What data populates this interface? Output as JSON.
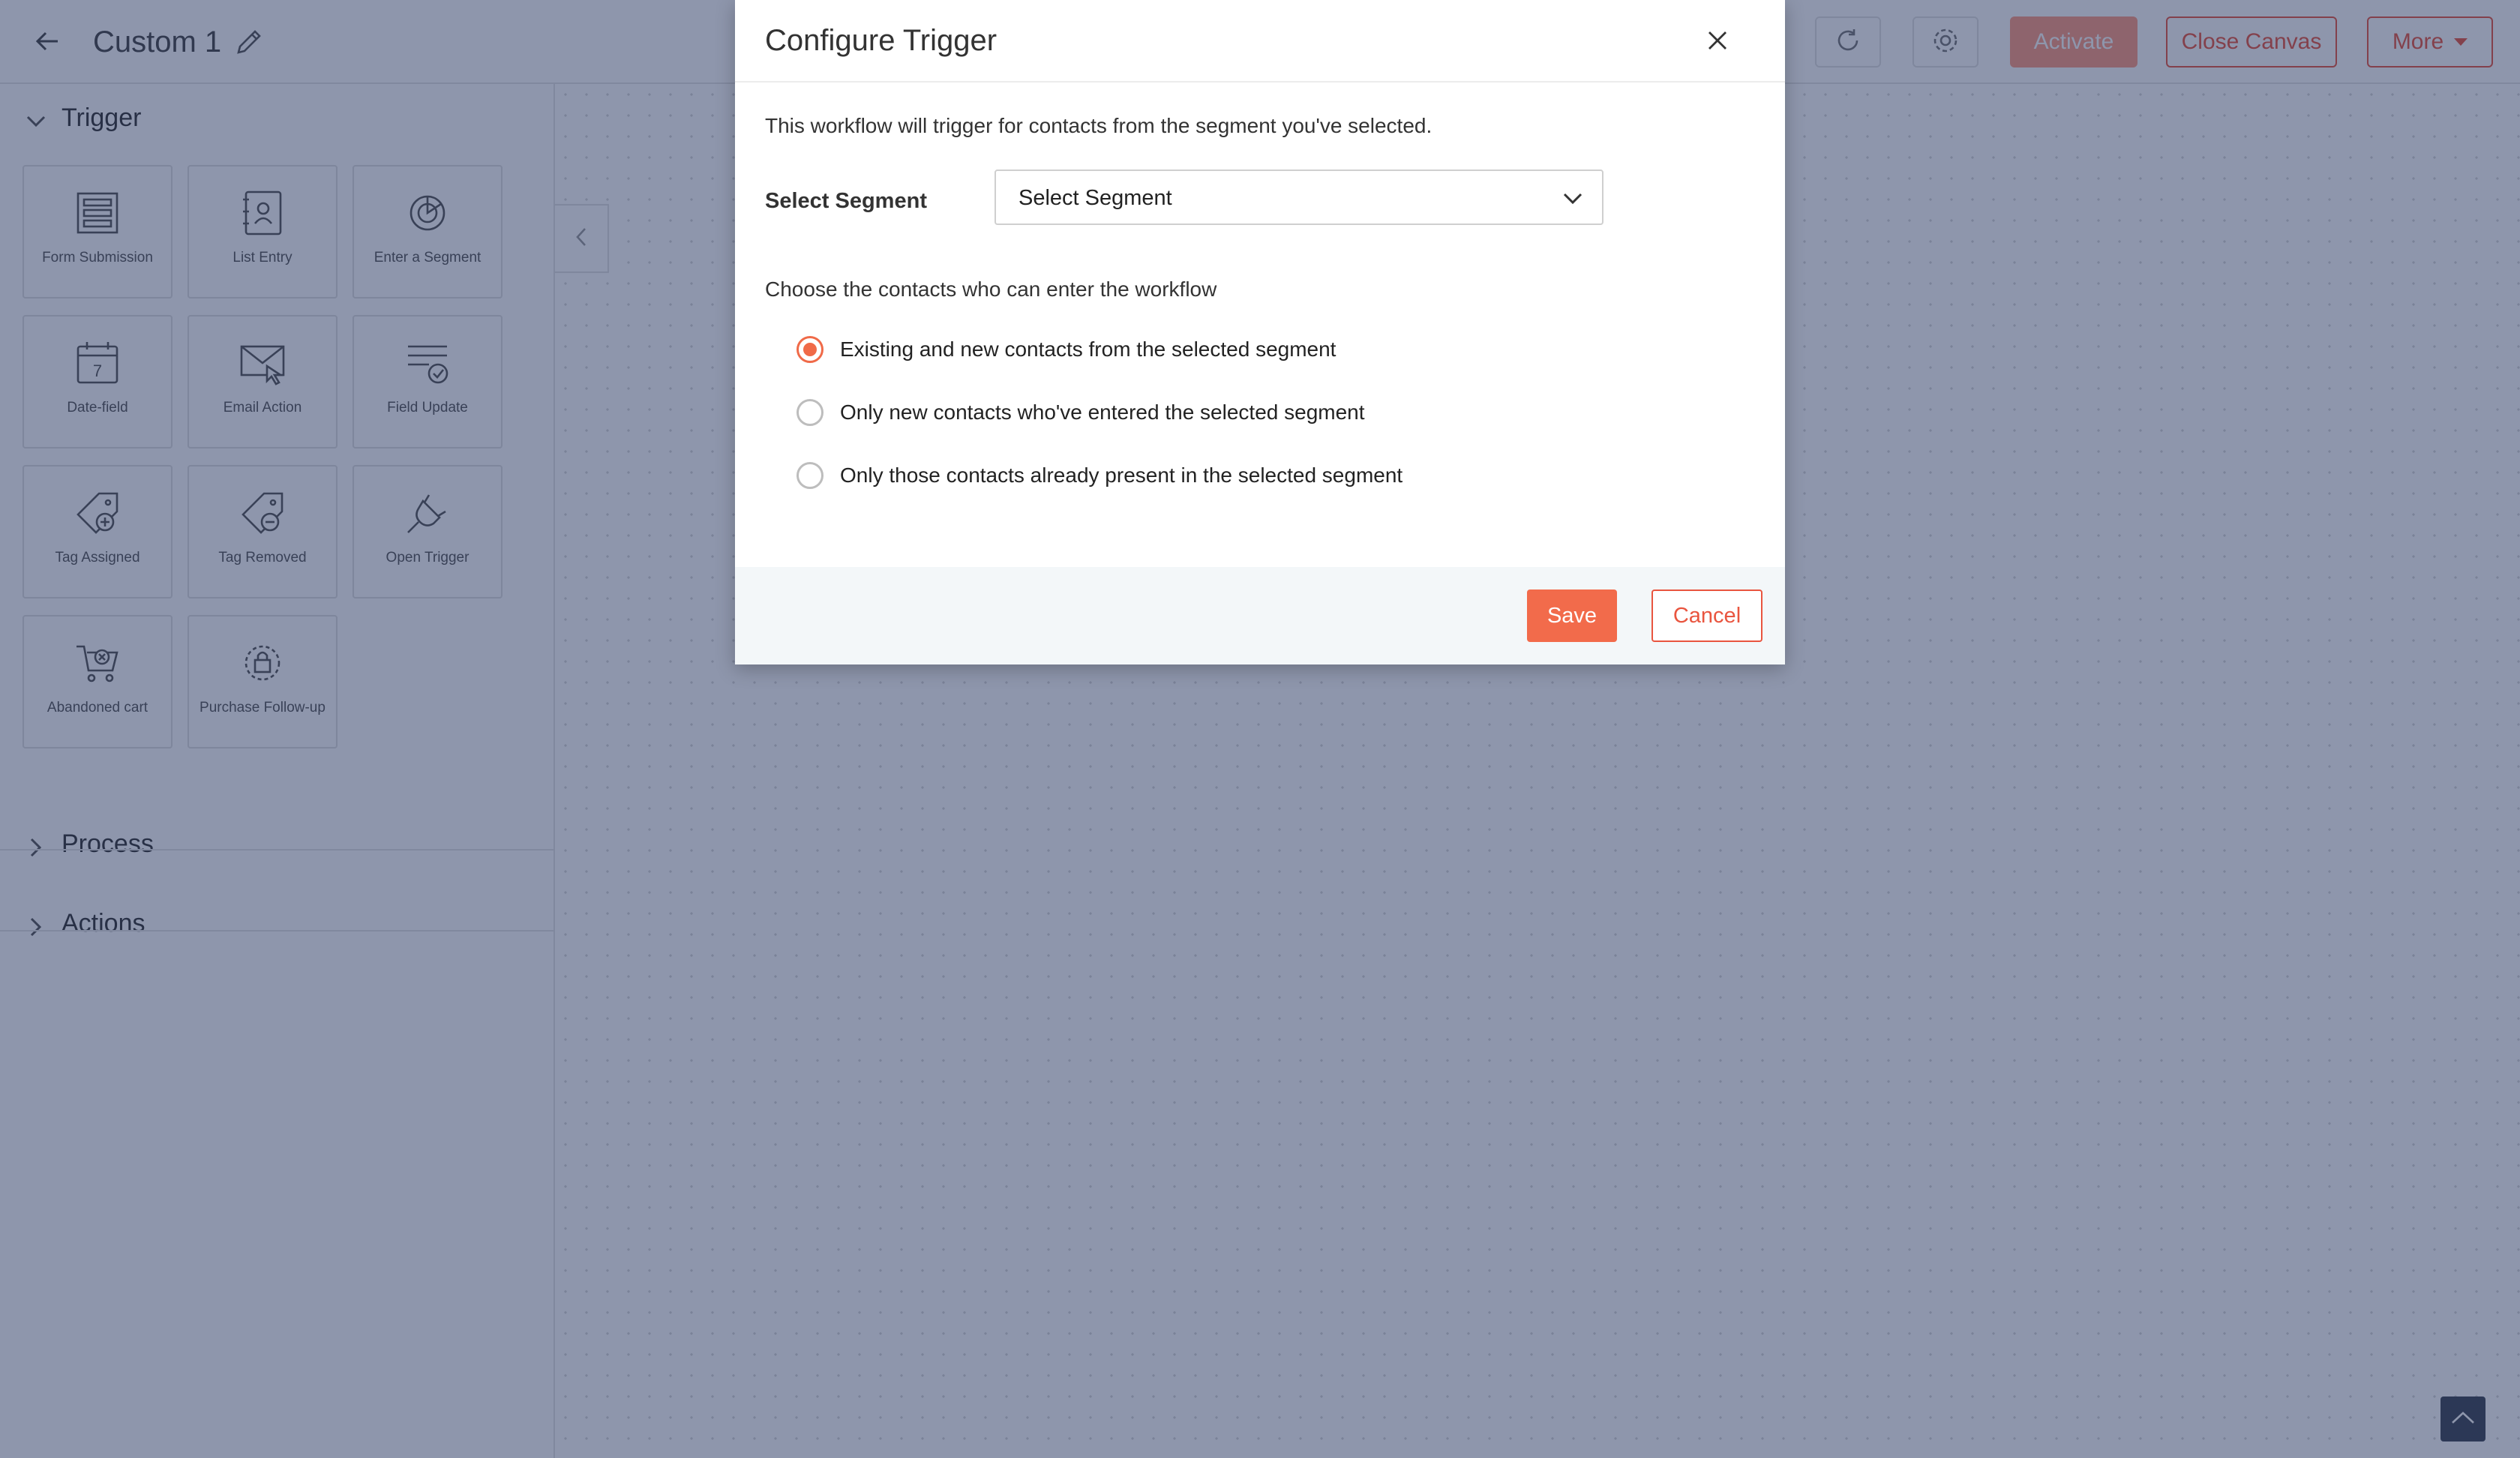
{
  "header": {
    "title": "Custom 1",
    "back_icon": "back-arrow-icon",
    "edit_icon": "pencil-icon",
    "activate_label": "Activate",
    "close_canvas_label": "Close Canvas",
    "more_label": "More"
  },
  "sidebar": {
    "sections": {
      "trigger": "Trigger",
      "process": "Process",
      "actions": "Actions"
    },
    "tiles": [
      {
        "label": "Form Submission",
        "icon": "form-submission-icon"
      },
      {
        "label": "List Entry",
        "icon": "list-entry-icon"
      },
      {
        "label": "Enter a Segment",
        "icon": "enter-segment-icon"
      },
      {
        "label": "Date-field",
        "icon": "calendar-icon"
      },
      {
        "label": "Email Action",
        "icon": "email-action-icon"
      },
      {
        "label": "Field Update",
        "icon": "field-update-icon"
      },
      {
        "label": "Tag Assigned",
        "icon": "tag-add-icon"
      },
      {
        "label": "Tag Removed",
        "icon": "tag-remove-icon"
      },
      {
        "label": "Open Trigger",
        "icon": "plug-icon"
      },
      {
        "label": "Abandoned cart",
        "icon": "cart-remove-icon"
      },
      {
        "label": "Purchase Follow-up",
        "icon": "purchase-follow-up-icon"
      }
    ],
    "calendar_day": "7"
  },
  "modal": {
    "title": "Configure Trigger",
    "description": "This workflow will trigger for contacts from the segment you've selected.",
    "segment_label": "Select Segment",
    "segment_value": "Select Segment",
    "choose_label": "Choose the contacts who can enter the workflow",
    "options": [
      {
        "label": "Existing and new contacts from the selected segment",
        "checked": true
      },
      {
        "label": "Only new contacts who've entered the selected segment",
        "checked": false
      },
      {
        "label": "Only those contacts already present in the selected segment",
        "checked": false
      }
    ],
    "save_label": "Save",
    "cancel_label": "Cancel"
  },
  "colors": {
    "accent": "#f26b4b",
    "overlay": "#1e2d5a"
  }
}
